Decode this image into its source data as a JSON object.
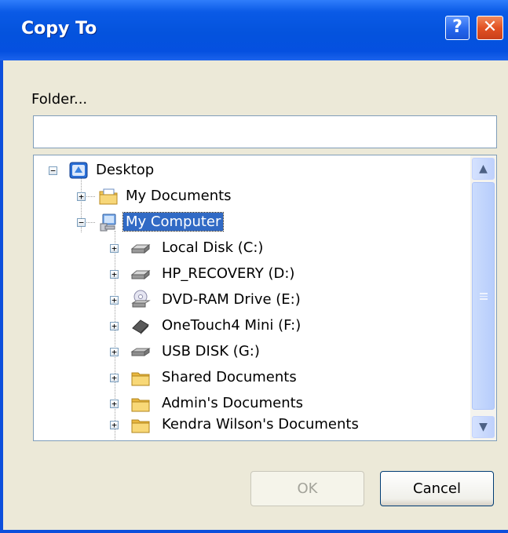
{
  "window": {
    "title": "Copy To",
    "help_button": "?",
    "close_button": "✕"
  },
  "folder": {
    "label": "Folder...",
    "value": "",
    "placeholder": ""
  },
  "tree": {
    "items": [
      {
        "label": "Desktop",
        "icon": "desktop-icon",
        "expander": "−",
        "selected": false
      },
      {
        "label": "My Documents",
        "icon": "my-documents-icon",
        "expander": "+",
        "selected": false
      },
      {
        "label": "My Computer",
        "icon": "my-computer-icon",
        "expander": "−",
        "selected": true
      },
      {
        "label": "Local Disk (C:)",
        "icon": "hard-disk-icon",
        "expander": "+",
        "selected": false
      },
      {
        "label": "HP_RECOVERY (D:)",
        "icon": "hard-disk-icon",
        "expander": "+",
        "selected": false
      },
      {
        "label": "DVD-RAM Drive (E:)",
        "icon": "dvd-drive-icon",
        "expander": "+",
        "selected": false
      },
      {
        "label": "OneTouch4 Mini (F:)",
        "icon": "removable-drive-icon",
        "expander": "+",
        "selected": false
      },
      {
        "label": "USB DISK (G:)",
        "icon": "usb-disk-icon",
        "expander": "+",
        "selected": false
      },
      {
        "label": "Shared Documents",
        "icon": "folder-icon",
        "expander": "+",
        "selected": false
      },
      {
        "label": "Admin's Documents",
        "icon": "folder-icon",
        "expander": "+",
        "selected": false
      },
      {
        "label": "Kendra Wilson's Documents",
        "icon": "folder-icon",
        "expander": "+",
        "selected": false
      }
    ]
  },
  "scrollbar": {
    "up_arrow": "▲",
    "down_arrow": "▼"
  },
  "buttons": {
    "ok": "OK",
    "cancel": "Cancel"
  },
  "colors": {
    "title_bar": "#0453dd",
    "selection": "#316ac5",
    "dialog_bg": "#ece9d8"
  }
}
